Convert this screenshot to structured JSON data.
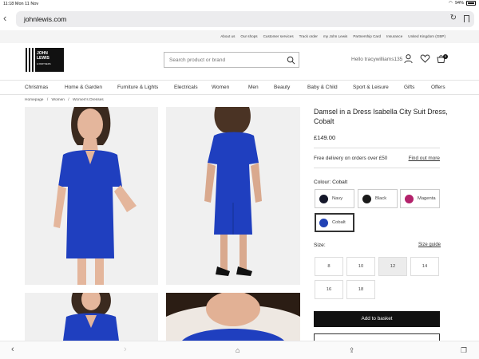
{
  "status_bar": {
    "time_date": "11:18  Mon 11 Nov",
    "battery": "94%"
  },
  "browser": {
    "url": "johnlewis.com"
  },
  "util_nav": [
    "About us",
    "Our shops",
    "Customer services",
    "Track order",
    "my John Lewis",
    "Partnership Card",
    "Insurance",
    "United Kingdom (GBP)"
  ],
  "header": {
    "logo_line1": "JOHN",
    "logo_line2": "LEWIS",
    "logo_line3": "& PARTNERS",
    "search_placeholder": "Search product or brand",
    "greeting": "Hello tracywilliams135",
    "basket_count": "0"
  },
  "nav": [
    "Christmas",
    "Home & Garden",
    "Furniture & Lights",
    "Electricals",
    "Women",
    "Men",
    "Beauty",
    "Baby & Child",
    "Sport & Leisure",
    "Gifts",
    "Offers"
  ],
  "breadcrumb": [
    "Homepage",
    "/",
    "Women",
    "/",
    "Women's Dresses"
  ],
  "product": {
    "title": "Damsel in a Dress Isabella City Suit Dress, Cobalt",
    "price": "£149.00",
    "delivery_text": "Free delivery on orders over £50",
    "delivery_link": "Find out more",
    "colour_label": "Colour: Cobalt",
    "colours": [
      {
        "name": "Navy",
        "hex": "#15182a"
      },
      {
        "name": "Black",
        "hex": "#1a1a1a"
      },
      {
        "name": "Magenta",
        "hex": "#b3226b"
      },
      {
        "name": "Cobalt",
        "hex": "#2142b5",
        "selected": true
      }
    ],
    "size_label": "Size:",
    "size_guide": "Size guide",
    "sizes": [
      "8",
      "10",
      "12",
      "14",
      "16",
      "18"
    ],
    "selected_size": "12",
    "add_to_basket": "Add to basket"
  },
  "colors": {
    "cobalt_dress": "#1f3fbf",
    "accent_black": "#111111"
  }
}
